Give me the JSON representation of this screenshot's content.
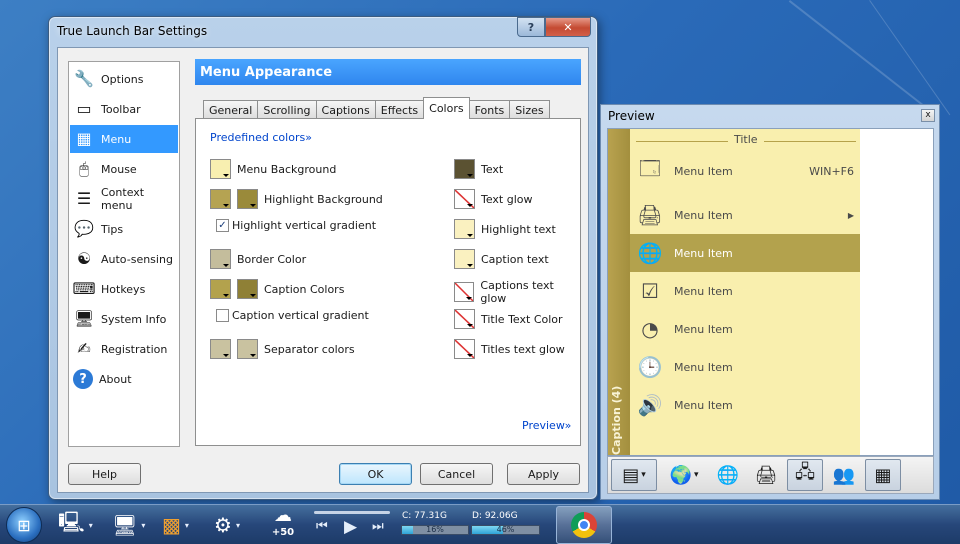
{
  "settings_window": {
    "title": "True Launch Bar Settings",
    "help_glyph": "?",
    "close_glyph": "✕",
    "nav": [
      {
        "label": "Options",
        "icon": "wrench-icon",
        "glyph": "🔧"
      },
      {
        "label": "Toolbar",
        "icon": "toolbar-icon",
        "glyph": "▭"
      },
      {
        "label": "Menu",
        "icon": "menu-icon",
        "glyph": "▦",
        "selected": true
      },
      {
        "label": "Mouse",
        "icon": "mouse-icon",
        "glyph": "🖱"
      },
      {
        "label": "Context menu",
        "icon": "context-menu-icon",
        "glyph": "☰"
      },
      {
        "label": "Tips",
        "icon": "speech-bubble-icon",
        "glyph": "💬"
      },
      {
        "label": "Auto-sensing",
        "icon": "yin-yang-icon",
        "glyph": "☯"
      },
      {
        "label": "Hotkeys",
        "icon": "keyboard-icon",
        "glyph": "⌨"
      },
      {
        "label": "System Info",
        "icon": "monitor-icon",
        "glyph": "🖥"
      },
      {
        "label": "Registration",
        "icon": "registration-icon",
        "glyph": "✍"
      },
      {
        "label": "About",
        "icon": "about-icon",
        "glyph": "?"
      }
    ],
    "header": "Menu Appearance",
    "tabs": [
      "General",
      "Scrolling",
      "Captions",
      "Effects",
      "Colors",
      "Fonts",
      "Sizes"
    ],
    "active_tab": "Colors",
    "predefined_link": "Predefined colors»",
    "preview_link": "Preview»",
    "left_column": {
      "menu_background": "Menu Background",
      "highlight_background": "Highlight Background",
      "highlight_vertical_gradient": "Highlight vertical gradient",
      "border_color": "Border Color",
      "caption_colors": "Caption Colors",
      "caption_vertical_gradient": "Caption vertical gradient",
      "separator_colors": "Separator colors"
    },
    "right_column": {
      "text": "Text",
      "text_glow": "Text glow",
      "highlight_text": "Highlight text",
      "caption_text": "Caption text",
      "captions_text_glow": "Captions text glow",
      "title_text_color": "Title Text Color",
      "titles_text_glow": "Titles text glow"
    },
    "checkbox_checked_glyph": "✓",
    "buttons": {
      "help": "Help",
      "ok": "OK",
      "cancel": "Cancel",
      "apply": "Apply"
    },
    "colors": {
      "menu_background": "#f8efb0",
      "highlight_background_1": "#b5a352",
      "highlight_background_2": "#9a8a3a",
      "border_color": "#c4bd9c",
      "caption_colors_1": "#b3a24d",
      "caption_colors_2": "#8f8036",
      "separator_colors_1": "#c9c2a0",
      "separator_colors_2": "#c9c2a0",
      "text": "#5b5232",
      "highlight_text": "#faf1c0",
      "caption_text": "#faf1c0"
    }
  },
  "preview_window": {
    "title": "Preview",
    "close_glyph": "x",
    "menu_title": "Title",
    "caption": "Caption (4)",
    "items": [
      {
        "label": "Menu Item",
        "shortcut": "WIN+F6",
        "icon": "window-icon",
        "glyph": "🗔"
      },
      {
        "label": "Menu Item",
        "submenu_arrow": "▶",
        "icon": "printer-icon",
        "glyph": "🖨"
      },
      {
        "label": "Menu Item",
        "highlighted": true,
        "icon": "network-globe-icon",
        "glyph": "🌐"
      },
      {
        "label": "Menu Item",
        "icon": "checklist-icon",
        "glyph": "☑"
      },
      {
        "label": "Menu Item",
        "icon": "pie-chart-icon",
        "glyph": "◔"
      },
      {
        "label": "Menu Item",
        "icon": "globe-clock-icon",
        "glyph": "🕒"
      },
      {
        "label": "Menu Item",
        "icon": "speaker-icon",
        "glyph": "🔊"
      }
    ],
    "toolbar": [
      {
        "icon": "chip-icon",
        "glyph": "▤",
        "pressed": true,
        "dropdown": true
      },
      {
        "icon": "globe-icon",
        "glyph": "🌍",
        "dropdown": true
      },
      {
        "icon": "globe-mouse-icon",
        "glyph": "🌐"
      },
      {
        "icon": "printer-icon",
        "glyph": "🖨"
      },
      {
        "icon": "network-icon",
        "glyph": "🖧",
        "pressed": true
      },
      {
        "icon": "users-icon",
        "glyph": "👥"
      },
      {
        "icon": "calculator-icon",
        "glyph": "▦",
        "pressed": true
      }
    ],
    "dropdown_glyph": "▾",
    "colors": {
      "menu_background": "#f9efae",
      "highlight": "#b3a24d",
      "caption": "#a38f3e"
    }
  },
  "taskbar": {
    "start_glyph": "⊞",
    "items": [
      {
        "icon": "computer-icon",
        "glyph": "🖳"
      },
      {
        "icon": "monitor-icon",
        "glyph": "🖥"
      },
      {
        "icon": "office-icon",
        "glyph": "▩"
      },
      {
        "icon": "settings-icon",
        "glyph": "⚙"
      }
    ],
    "dropdown_glyph": "▾",
    "weather_icon": "weather-icon",
    "weather_glyph": "☁",
    "weather_temp": "+50",
    "media": {
      "prev": "⏮",
      "play": "▶",
      "next": "⏭"
    },
    "disk_c": {
      "label": "C: 77.31G",
      "percent_label": "16%",
      "percent": 16
    },
    "disk_d": {
      "label": "D: 92.06G",
      "percent_label": "46%",
      "percent": 46
    },
    "chrome_icon": "chrome-icon"
  }
}
